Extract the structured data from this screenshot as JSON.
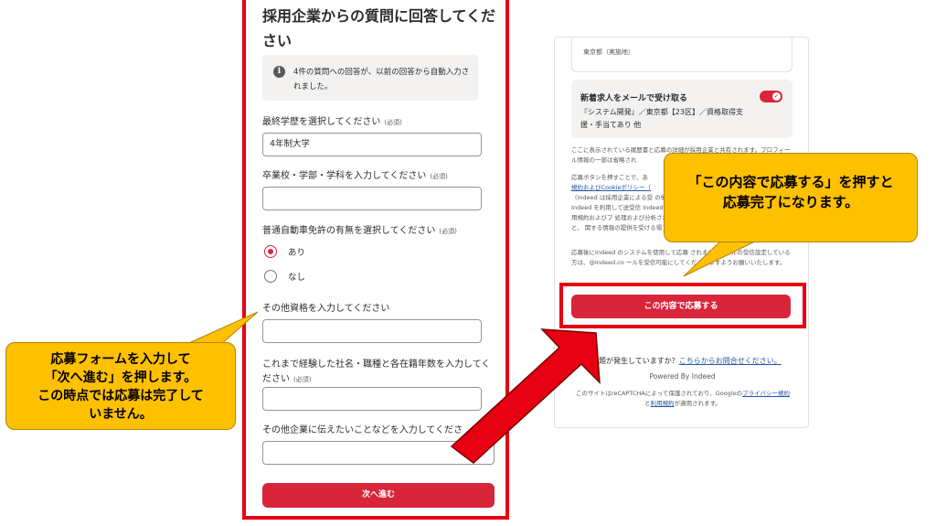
{
  "form": {
    "title": "採用企業からの質問に回答してください",
    "info_text": "4件の質問への回答が、以前の回答から自動入力されました。",
    "questions": [
      {
        "label": "最終学歴を選択してください",
        "required": "(必須)",
        "value": "4年制大学"
      },
      {
        "label": "卒業校・学部・学科を入力してください",
        "required": "(必須)",
        "value": ""
      },
      {
        "label": "普通自動車免許の有無を選択してください",
        "required": "(必須)"
      },
      {
        "label": "その他資格を入力してください",
        "required": "",
        "value": ""
      },
      {
        "label": "これまで経験した社名・職種と各在籍年数を入力してください",
        "required": "(必須)",
        "value": ""
      },
      {
        "label": "その他企業に伝えたいことなどを入力してくださ",
        "required": "",
        "value": ""
      }
    ],
    "radio_options": [
      {
        "label": "あり",
        "selected": true
      },
      {
        "label": "なし",
        "selected": false
      }
    ],
    "next_button": "次へ進む"
  },
  "confirm": {
    "top_card_text": "東京都（実施地）",
    "alert_title": "新着求人をメールで受け取る",
    "alert_desc": "『システム開発』／東京都【23区】／資格取得支援・手当てあり 他",
    "toggle_on": true,
    "toggle_check": "✓",
    "share_notice": "ここに表示されている履歴書と応募の詳細が採用企業と共有されます。プロフィール情報の一部は省略され",
    "terms_intro": "応募ボタンを押すことで、あ",
    "terms_link": "規約およびCookieポリシー（",
    "terms_body": "（Indeed は採用企業による受 の他 Indeed を利用して送受信 Indeed の利用規約およびプ 処理および分析されること、 関する情報の提供を受ける場",
    "email_notice": "応募後にIndeed のシステムを使用して応募 されます。メールの受信設定している方は、@indeed.co ールを受信可能にしてくださいますようお願いいたします。",
    "apply_button": "この内容で応募する",
    "problem_prefix": "問題が発生していますか？",
    "problem_link": "こちらからお問合せください。",
    "powered_by": "Powered By Indeed",
    "recaptcha_prefix": "このサイトはreCAPTCHAによって保護されており、Googleの",
    "privacy_link": "プライバシー規約",
    "recaptcha_and": "と",
    "terms_of_use_link": "利用規約",
    "recaptcha_suffix": "が適用されます。"
  },
  "callouts": {
    "right_line1": "「この内容で応募する」を押すと",
    "right_line2": "応募完了になります。",
    "left_line1": "応募フォームを入力して",
    "left_line2": "「次へ進む」を押します。",
    "left_line3": "この時点では応募は完了して",
    "left_line4": "いません。"
  },
  "colors": {
    "highlight_red": "#e60012",
    "button_red": "#d8253a",
    "callout_yellow": "#ffc000",
    "link_blue": "#2557a7"
  }
}
